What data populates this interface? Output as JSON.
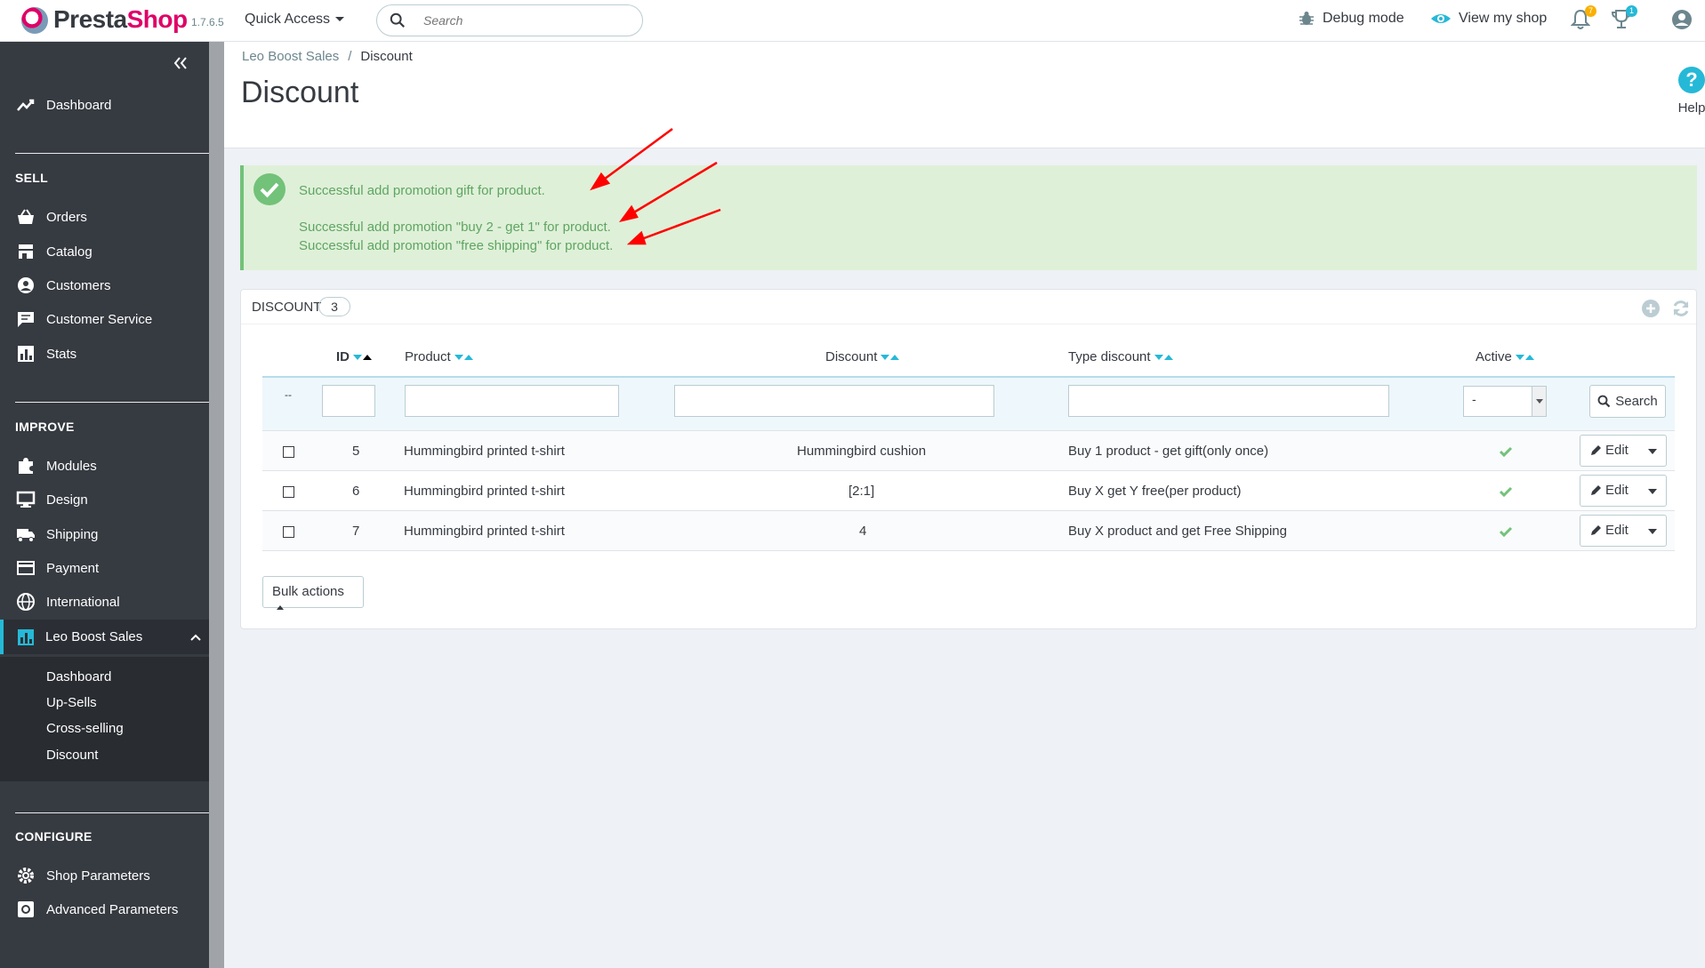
{
  "topbar": {
    "brand_a": "Presta",
    "brand_b": "Shop",
    "version": "1.7.6.5",
    "quick_access": "Quick Access",
    "search_placeholder": "Search",
    "debug_mode": "Debug mode",
    "view_shop": "View my shop",
    "notif_count": "7",
    "trophy_count": "1"
  },
  "sidebar": {
    "dashboard": "Dashboard",
    "sell_label": "SELL",
    "sell": [
      "Orders",
      "Catalog",
      "Customers",
      "Customer Service",
      "Stats"
    ],
    "improve_label": "IMPROVE",
    "improve": [
      "Modules",
      "Design",
      "Shipping",
      "Payment",
      "International"
    ],
    "leo": "Leo Boost Sales",
    "leo_sub": [
      "Dashboard",
      "Up-Sells",
      "Cross-selling",
      "Discount"
    ],
    "configure_label": "CONFIGURE",
    "configure": [
      "Shop Parameters",
      "Advanced Parameters"
    ]
  },
  "header": {
    "breadcrumb_parent": "Leo Boost Sales",
    "breadcrumb_sep": "/",
    "breadcrumb_current": "Discount",
    "title": "Discount",
    "help": "Help",
    "help_glyph": "?"
  },
  "alert": {
    "messages": [
      "Successful add promotion gift for product.",
      "Successful add promotion \"buy 2 - get 1\" for product.",
      "Successful add promotion \"free shipping\" for product."
    ]
  },
  "panel": {
    "title": "Discount",
    "count": "3",
    "columns": [
      "ID",
      "Product",
      "Discount",
      "Type discount",
      "Active"
    ],
    "filter_dash": "--",
    "active_filter": "-",
    "search_btn": "Search",
    "rows": [
      {
        "id": "5",
        "product": "Hummingbird printed t-shirt",
        "discount": "Hummingbird cushion",
        "type": "Buy 1 product - get gift(only once)",
        "active": true
      },
      {
        "id": "6",
        "product": "Hummingbird printed t-shirt",
        "discount": "[2:1]",
        "type": "Buy X get Y free(per product)",
        "active": true
      },
      {
        "id": "7",
        "product": "Hummingbird printed t-shirt",
        "discount": "4",
        "type": "Buy X product and get Free Shipping",
        "active": true
      }
    ],
    "edit_label": "Edit",
    "bulk_actions": "Bulk actions"
  },
  "colors": {
    "accent": "#25b9d7",
    "sidebar": "#363a41",
    "success_bg": "#dff0d8",
    "success_text": "#5ea562",
    "brand_pink": "#df0067",
    "check_green": "#72c279",
    "annotation_red": "#ff0000"
  },
  "icons": [
    "logo-icon",
    "search-icon",
    "bug-icon",
    "eye-icon",
    "bell-icon",
    "trophy-icon",
    "user-icon",
    "chevron-double-left-icon",
    "trend-icon",
    "basket-icon",
    "store-icon",
    "user-circle-icon",
    "chat-icon",
    "chart-icon",
    "puzzle-icon",
    "desktop-icon",
    "truck-icon",
    "card-icon",
    "globe-icon",
    "chevron-up-icon",
    "gear-icon",
    "settings-icon",
    "check-circle-icon",
    "plus-circle-icon",
    "refresh-icon",
    "pencil-icon",
    "check-icon",
    "caret-down-icon"
  ]
}
